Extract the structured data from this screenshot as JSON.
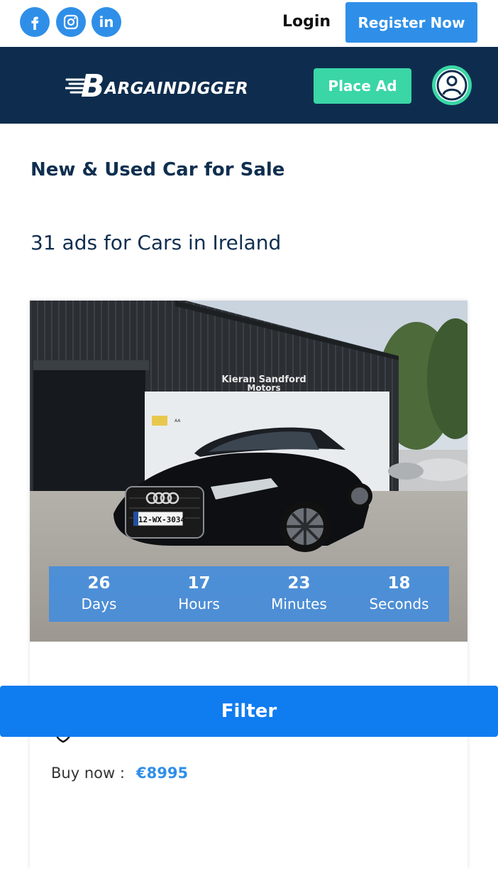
{
  "header": {
    "social": [
      {
        "name": "facebook",
        "glyph": "f"
      },
      {
        "name": "instagram",
        "glyph": "ig"
      },
      {
        "name": "linkedin",
        "glyph": "in"
      }
    ],
    "login_label": "Login",
    "register_label": "Register Now"
  },
  "nav": {
    "logo_initial": "B",
    "logo_text": "ARGAINDIGGER",
    "place_ad_label": "Place Ad"
  },
  "page": {
    "title": "New & Used Car for Sale",
    "ads_count": "31 ads for Cars in Ireland"
  },
  "listing": {
    "photo_sign_line1": "Kieran Sandford",
    "photo_sign_line2": "Motors",
    "plate": "12-WX-3034",
    "countdown": [
      {
        "value": "26",
        "label": "Days"
      },
      {
        "value": "17",
        "label": "Hours"
      },
      {
        "value": "23",
        "label": "Minutes"
      },
      {
        "value": "18",
        "label": "Seconds"
      }
    ],
    "buy_label": "Buy now :",
    "price": "€8995"
  },
  "filter_label": "Filter",
  "colors": {
    "accent_blue": "#2f8fe8",
    "nav_bg": "#0e2d4e",
    "mint": "#3ad6a6",
    "filter_blue": "#0f7cf0"
  }
}
